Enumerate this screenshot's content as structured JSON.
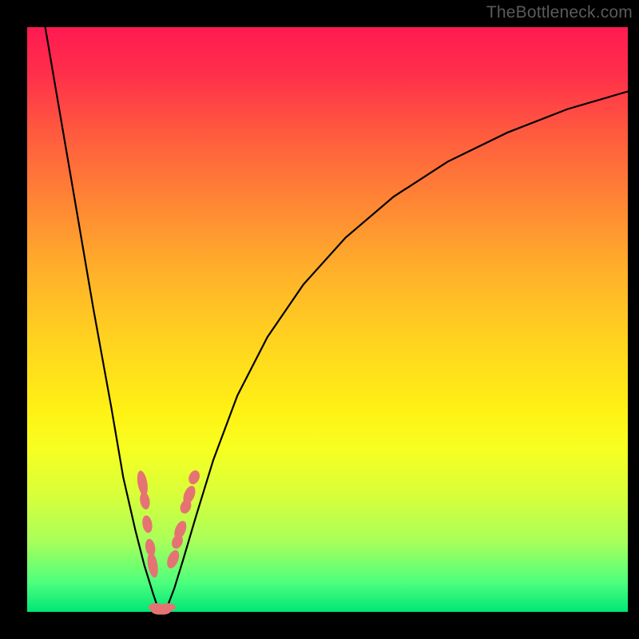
{
  "watermark": "TheBottleneck.com",
  "chart_data": {
    "type": "line",
    "title": "",
    "xlabel": "",
    "ylabel": "",
    "xlim": [
      0,
      100
    ],
    "ylim": [
      0,
      100
    ],
    "grid": false,
    "series": [
      {
        "name": "left-branch",
        "color": "#000000",
        "x": [
          3,
          5,
          8,
          11,
          14,
          16,
          18,
          19.5,
          21,
          22
        ],
        "y": [
          100,
          88,
          70,
          52,
          35,
          23,
          14,
          8,
          3,
          0
        ]
      },
      {
        "name": "right-branch",
        "color": "#000000",
        "x": [
          23,
          24.5,
          26,
          28,
          31,
          35,
          40,
          46,
          53,
          61,
          70,
          80,
          90,
          100
        ],
        "y": [
          0,
          4,
          9,
          16,
          26,
          37,
          47,
          56,
          64,
          71,
          77,
          82,
          86,
          89
        ]
      }
    ],
    "markers": {
      "color": "#e57373",
      "left_branch": [
        {
          "x": 19.2,
          "y": 22
        },
        {
          "x": 19.6,
          "y": 19
        },
        {
          "x": 20.0,
          "y": 15
        },
        {
          "x": 20.5,
          "y": 11
        },
        {
          "x": 20.9,
          "y": 8
        }
      ],
      "right_branch": [
        {
          "x": 24.3,
          "y": 9
        },
        {
          "x": 25.0,
          "y": 12
        },
        {
          "x": 25.5,
          "y": 14
        },
        {
          "x": 26.4,
          "y": 18
        },
        {
          "x": 27.0,
          "y": 20
        },
        {
          "x": 27.8,
          "y": 23
        }
      ],
      "valley": [
        {
          "x": 21.5,
          "y": 0.8
        },
        {
          "x": 22.0,
          "y": 0.2
        },
        {
          "x": 22.6,
          "y": 0.2
        },
        {
          "x": 23.4,
          "y": 0.8
        }
      ]
    }
  }
}
